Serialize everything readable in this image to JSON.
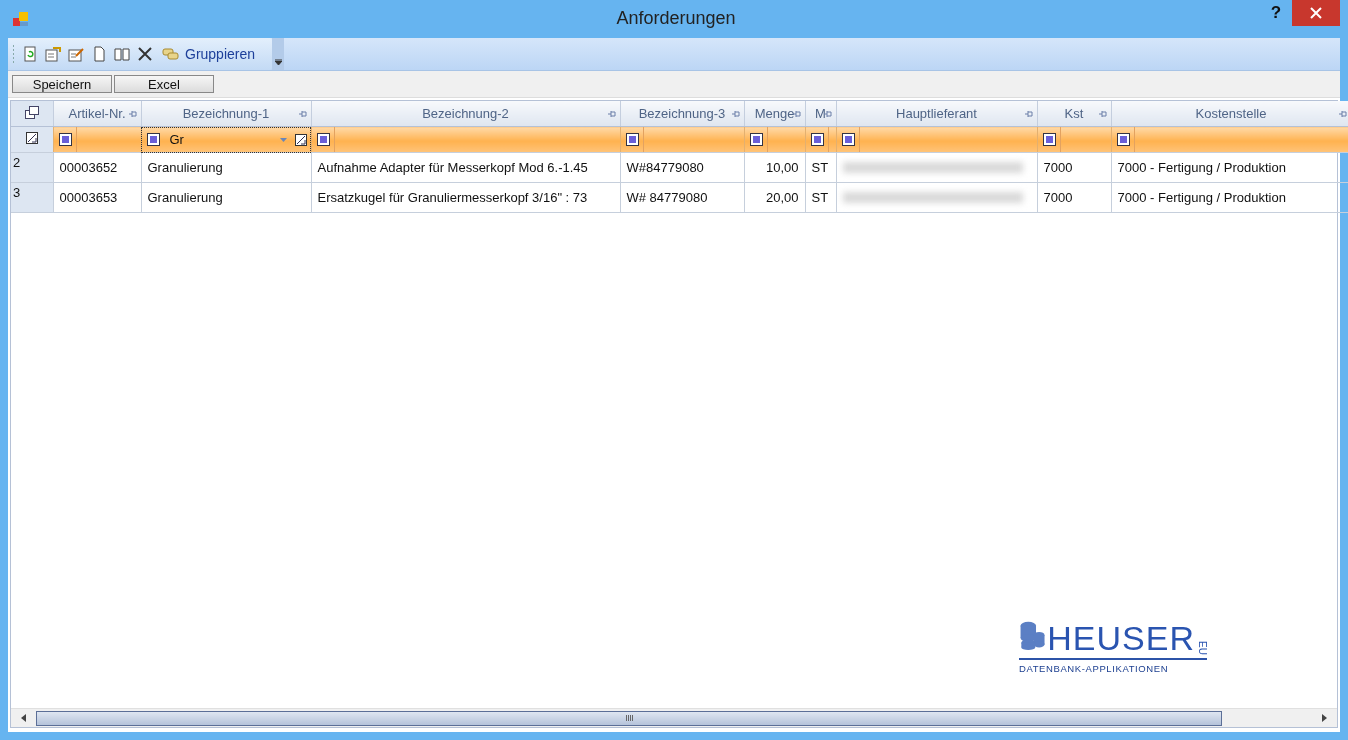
{
  "window": {
    "title": "Anforderungen",
    "help": "?"
  },
  "toolbar": {
    "group_button": "Gruppieren"
  },
  "buttons": [
    "Speichern",
    "Excel"
  ],
  "table": {
    "columns": [
      {
        "label": "Artikel-Nr.",
        "numeric": false
      },
      {
        "label": "Bezeichnung-1",
        "numeric": false,
        "filter": "Gr"
      },
      {
        "label": "Bezeichnung-2",
        "numeric": false
      },
      {
        "label": "Bezeichnung-3",
        "numeric": false
      },
      {
        "label": "Menge",
        "numeric": true
      },
      {
        "label": "M",
        "numeric": false
      },
      {
        "label": "Hauptlieferant",
        "numeric": false
      },
      {
        "label": "Kst",
        "numeric": false
      },
      {
        "label": "Kostenstelle",
        "numeric": false
      }
    ],
    "rows": [
      {
        "header": "2",
        "cells": [
          {
            "text": "00003652"
          },
          {
            "text": "Granulierung"
          },
          {
            "text": "Aufnahme Adapter für Messerkopf Mod 6.-1.45"
          },
          {
            "text": "W#84779080"
          },
          {
            "text": "10,00"
          },
          {
            "text": "ST"
          },
          {
            "blurred": true
          },
          {
            "text": "7000"
          },
          {
            "text": "7000 - Fertigung / Produktion"
          }
        ]
      },
      {
        "header": "3",
        "cells": [
          {
            "text": "00003653"
          },
          {
            "text": "Granulierung"
          },
          {
            "text": "Ersatzkugel für Granuliermesserkopf 3/16\"  : 73"
          },
          {
            "text": "W# 84779080"
          },
          {
            "text": "20,00"
          },
          {
            "text": "ST"
          },
          {
            "blurred": true
          },
          {
            "text": "7000"
          },
          {
            "text": "7000 - Fertigung / Produktion"
          }
        ]
      }
    ]
  },
  "logo": {
    "name": "HEUSER",
    "suffix": "EU",
    "tagline": "DATENBANK-APPLIKATIONEN"
  }
}
